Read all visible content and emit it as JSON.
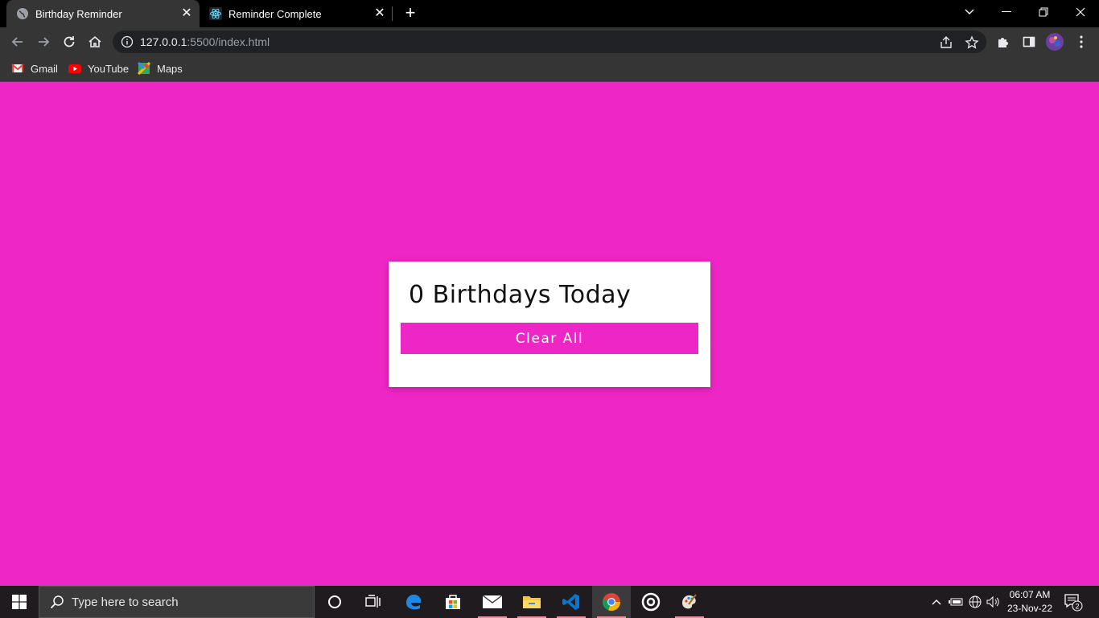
{
  "browser": {
    "tabs": [
      {
        "title": "Birthday Reminder",
        "active": true
      },
      {
        "title": "Reminder Complete",
        "active": false
      }
    ],
    "address": {
      "host": "127.0.0.1",
      "rest": ":5500/index.html"
    },
    "bookmarks": [
      {
        "label": "Gmail",
        "icon": "gmail-icon"
      },
      {
        "label": "YouTube",
        "icon": "youtube-icon"
      },
      {
        "label": "Maps",
        "icon": "maps-icon"
      }
    ]
  },
  "page": {
    "heading": "0 Birthdays Today",
    "clear_label": "Clear All",
    "background_color": "#ef26c6",
    "card_color": "#ffffff"
  },
  "taskbar": {
    "search_placeholder": "Type here to search",
    "time": "06:07 AM",
    "date": "23-Nov-22",
    "notification_count": "2"
  }
}
